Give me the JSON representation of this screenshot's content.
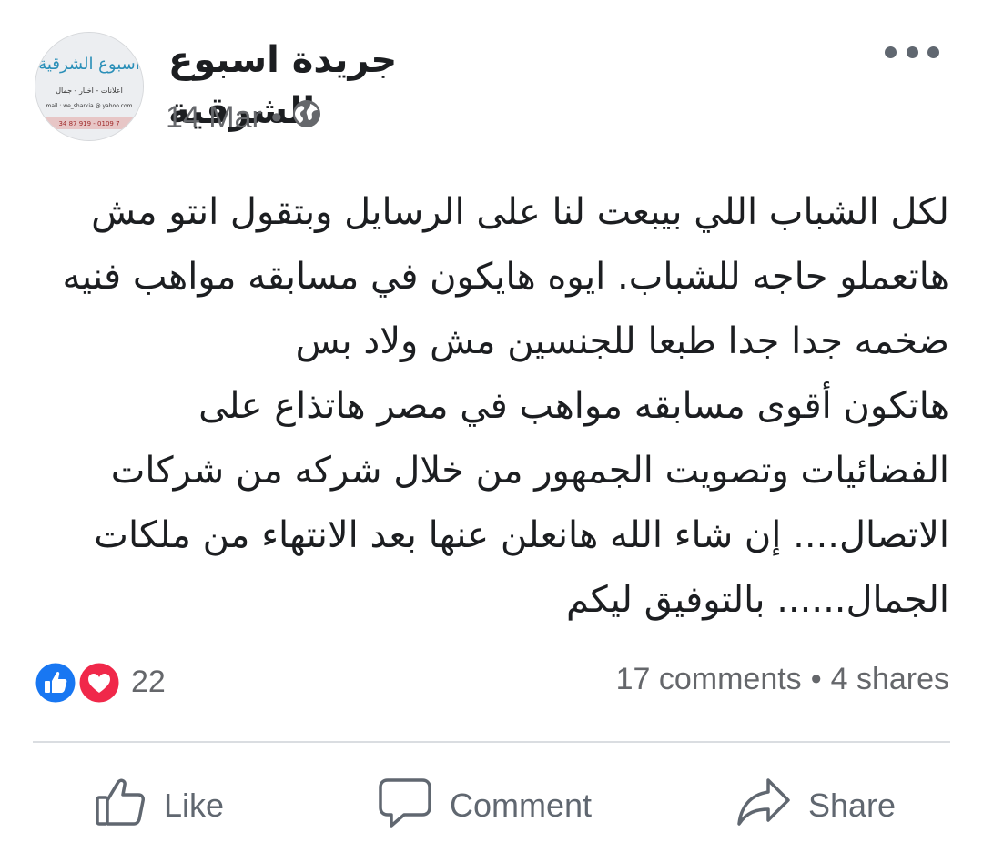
{
  "post": {
    "page_name": "جريدة اسبوع الشرقية",
    "date": "14 Mar",
    "separator": "•",
    "privacy_icon": "globe-icon",
    "more_icon": "more-dots-icon",
    "avatar": {
      "logo_text": "اسبوع الشرقية",
      "tagline": "اعلانات - اخبار - جمال",
      "email": "mail : we_sharkia @ yahoo.com",
      "phone": "34 87 919 - 0109 7"
    },
    "body": "لكل الشباب اللي بيبعت لنا على الرسايل وبتقول انتو مش\nهاتعملو حاجه للشباب. ايوه هايكون في مسابقه مواهب فنيه\nضخمه جدا جدا  طبعا للجنسين مش ولاد بس\nهاتكون أقوى مسابقه مواهب في مصر  هاتذاع على\nالفضائيات  وتصويت الجمهور من خلال شركه من شركات\nالاتصال.... إن شاء الله هانعلن عنها  بعد الانتهاء من ملكات\nالجمال...... بالتوفيق ليكم"
  },
  "reactions": {
    "count": "22",
    "icons": [
      "like-reaction-icon",
      "love-reaction-icon"
    ],
    "colors": {
      "like": "#1877f2",
      "love": "#f0284a"
    }
  },
  "stats": {
    "comments": "17 comments",
    "dot": "•",
    "shares": "4 shares"
  },
  "actions": {
    "like_label": "Like",
    "comment_label": "Comment",
    "share_label": "Share"
  }
}
